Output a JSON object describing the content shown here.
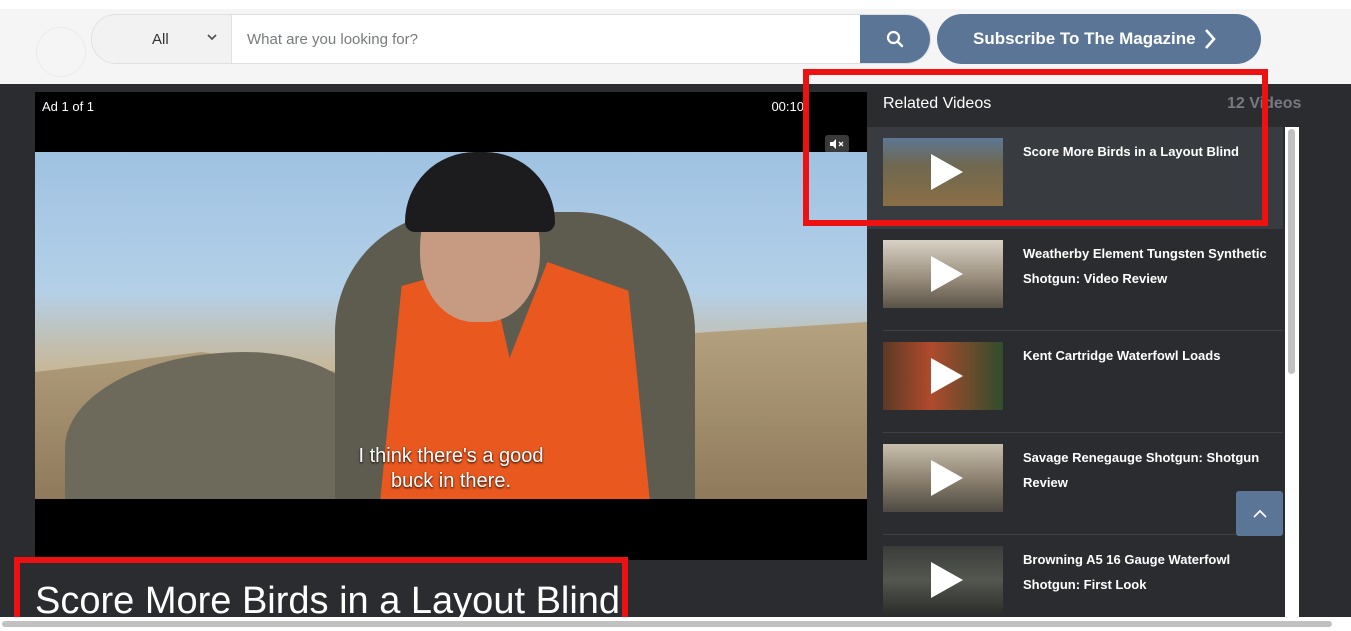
{
  "search": {
    "category_selected": "All",
    "placeholder": "What are you looking for?",
    "value": ""
  },
  "header": {
    "subscribe_label": "Subscribe To The Magazine"
  },
  "player": {
    "ad_label": "Ad 1 of 1",
    "ad_time": "00:10",
    "caption_line1": "I think there's a good",
    "caption_line2": "buck in there.",
    "title": "Score More Birds in a Layout Blind"
  },
  "related": {
    "header": "Related Videos",
    "count": "12 Videos",
    "items": [
      {
        "title": "Score More Birds in a Layout Blind"
      },
      {
        "title": "Weatherby Element Tungsten Synthetic Shotgun: Video Review"
      },
      {
        "title": "Kent Cartridge Waterfowl Loads"
      },
      {
        "title": "Savage Renegauge Shotgun: Shotgun Review"
      },
      {
        "title": "Browning A5 16 Gauge Waterfowl Shotgun: First Look"
      }
    ]
  },
  "colors": {
    "accent": "#5a7596",
    "background": "#2a2c30",
    "highlight": "#ee1111"
  },
  "icons": {
    "search": "search-icon",
    "chevron_right": "chevron-right-icon",
    "chevron_down": "chevron-down-icon",
    "mute": "mute-icon",
    "back_to_top": "chevron-up-icon",
    "play": "play-icon"
  }
}
